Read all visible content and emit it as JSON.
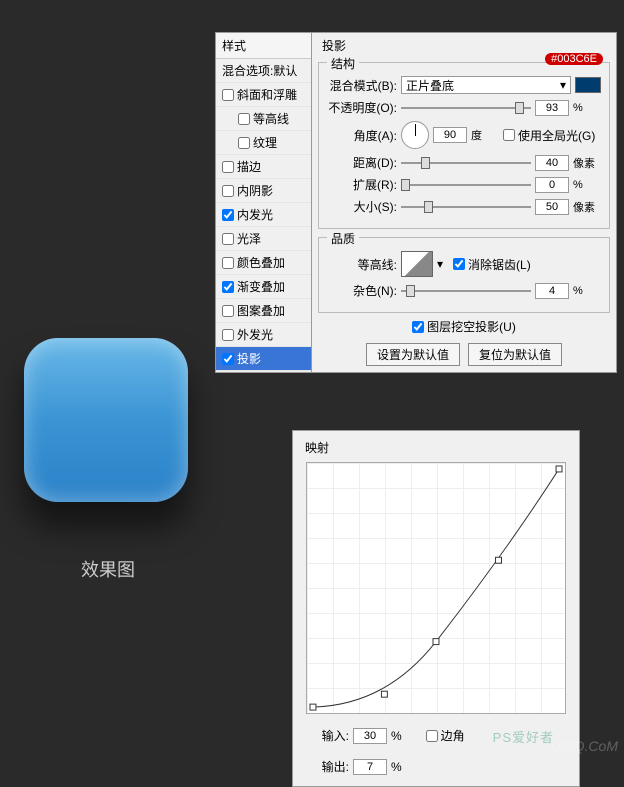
{
  "preview": {
    "label": "效果图"
  },
  "styles": {
    "header": "样式",
    "blend_defaults": "混合选项:默认",
    "items": [
      {
        "label": "斜面和浮雕",
        "checked": false,
        "indent": false
      },
      {
        "label": "等高线",
        "checked": false,
        "indent": true
      },
      {
        "label": "纹理",
        "checked": false,
        "indent": true
      },
      {
        "label": "描边",
        "checked": false,
        "indent": false
      },
      {
        "label": "内阴影",
        "checked": false,
        "indent": false
      },
      {
        "label": "内发光",
        "checked": true,
        "indent": false
      },
      {
        "label": "光泽",
        "checked": false,
        "indent": false
      },
      {
        "label": "颜色叠加",
        "checked": false,
        "indent": false
      },
      {
        "label": "渐变叠加",
        "checked": true,
        "indent": false
      },
      {
        "label": "图案叠加",
        "checked": false,
        "indent": false
      },
      {
        "label": "外发光",
        "checked": false,
        "indent": false
      },
      {
        "label": "投影",
        "checked": true,
        "indent": false,
        "selected": true
      }
    ]
  },
  "shadow": {
    "panel_title": "投影",
    "structure": "结构",
    "badge": "#003C6E",
    "blend_mode_label": "混合模式(B):",
    "blend_mode_value": "正片叠底",
    "opacity_label": "不透明度(O):",
    "opacity_value": "93",
    "percent": "%",
    "angle_label": "角度(A):",
    "angle_value": "90",
    "degree": "度",
    "global_light": "使用全局光(G)",
    "distance_label": "距离(D):",
    "distance_value": "40",
    "px": "像素",
    "spread_label": "扩展(R):",
    "spread_value": "0",
    "size_label": "大小(S):",
    "size_value": "50",
    "quality": "品质",
    "contour_label": "等高线:",
    "antialias": "消除锯齿(L)",
    "noise_label": "杂色(N):",
    "noise_value": "4",
    "knockout": "图层挖空投影(U)",
    "set_default": "设置为默认值",
    "reset_default": "复位为默认值"
  },
  "curve": {
    "title": "映射",
    "input_label": "输入:",
    "input_value": "30",
    "output_label": "输出:",
    "output_value": "7",
    "percent": "%",
    "corner": "边角"
  },
  "watermark": "UiBQ.CoM",
  "watermark2": "PS爱好者"
}
